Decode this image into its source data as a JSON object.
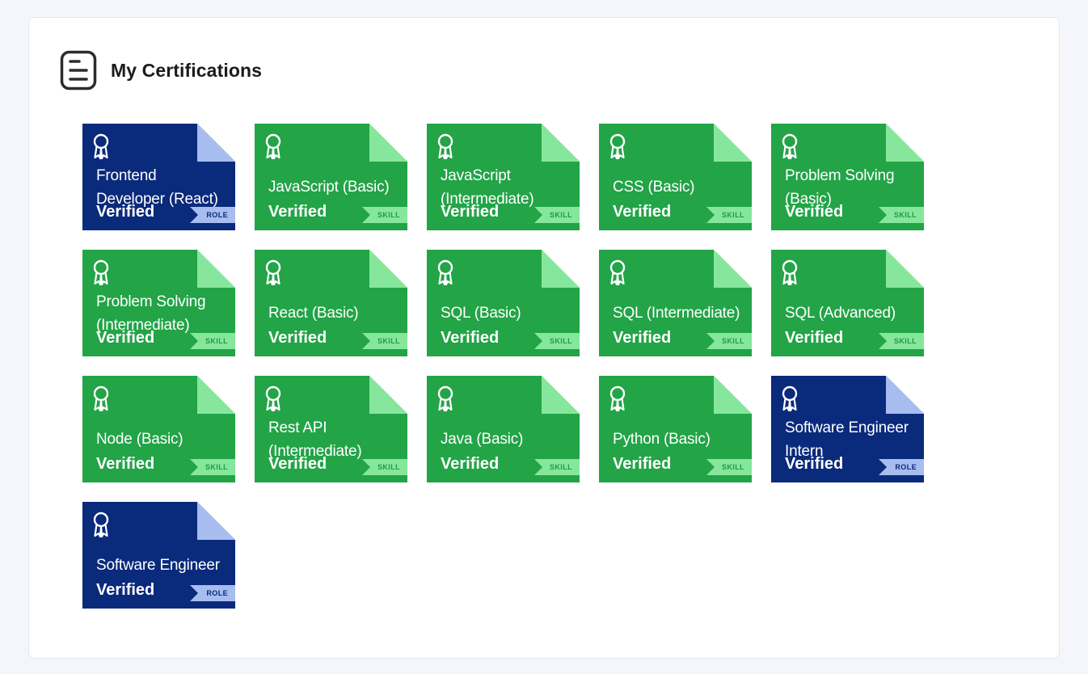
{
  "section": {
    "title": "My Certifications",
    "icon": "document-list-icon"
  },
  "colors": {
    "skill_bg": "#22a447",
    "skill_accent": "#86e79c",
    "role_bg": "#0a2a7b",
    "role_accent": "#a7bdf0"
  },
  "certifications": [
    {
      "title": "Frontend Developer (React)",
      "status": "Verified",
      "tag": "ROLE",
      "kind": "role"
    },
    {
      "title": "JavaScript (Basic)",
      "status": "Verified",
      "tag": "SKILL",
      "kind": "skill"
    },
    {
      "title": "JavaScript (Intermediate)",
      "status": "Verified",
      "tag": "SKILL",
      "kind": "skill"
    },
    {
      "title": "CSS (Basic)",
      "status": "Verified",
      "tag": "SKILL",
      "kind": "skill"
    },
    {
      "title": "Problem Solving (Basic)",
      "status": "Verified",
      "tag": "SKILL",
      "kind": "skill"
    },
    {
      "title": "Problem Solving (Intermediate)",
      "status": "Verified",
      "tag": "SKILL",
      "kind": "skill"
    },
    {
      "title": "React (Basic)",
      "status": "Verified",
      "tag": "SKILL",
      "kind": "skill"
    },
    {
      "title": "SQL (Basic)",
      "status": "Verified",
      "tag": "SKILL",
      "kind": "skill"
    },
    {
      "title": "SQL (Intermediate)",
      "status": "Verified",
      "tag": "SKILL",
      "kind": "skill"
    },
    {
      "title": "SQL (Advanced)",
      "status": "Verified",
      "tag": "SKILL",
      "kind": "skill"
    },
    {
      "title": "Node (Basic)",
      "status": "Verified",
      "tag": "SKILL",
      "kind": "skill"
    },
    {
      "title": "Rest API (Intermediate)",
      "status": "Verified",
      "tag": "SKILL",
      "kind": "skill"
    },
    {
      "title": "Java (Basic)",
      "status": "Verified",
      "tag": "SKILL",
      "kind": "skill"
    },
    {
      "title": "Python (Basic)",
      "status": "Verified",
      "tag": "SKILL",
      "kind": "skill"
    },
    {
      "title": "Software Engineer Intern",
      "status": "Verified",
      "tag": "ROLE",
      "kind": "role"
    },
    {
      "title": "Software Engineer",
      "status": "Verified",
      "tag": "ROLE",
      "kind": "role"
    }
  ]
}
